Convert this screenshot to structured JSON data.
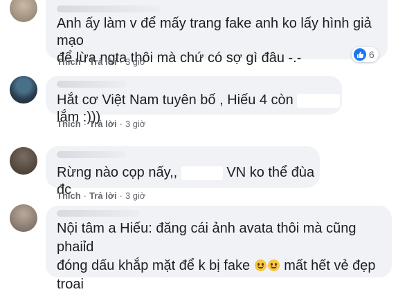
{
  "comments": [
    {
      "line1": "Anh ấy làm v để mấy trang fake anh ko lấy hình giả mạo",
      "line2": "để lừa ngta thôi mà chứ có sợ gì đâu -.-",
      "reaction_count": "6"
    },
    {
      "text_before": "Hắt cơ Việt Nam tuyên bố , Hiếu 4 còn",
      "text_after": "lắm :)))"
    },
    {
      "text_before": "Rừng nào cọp nấy,,",
      "text_after": "VN ko thể đùa đc"
    },
    {
      "line1": "Nội tâm a Hiếu: đăng cái ảnh avata thôi mà cũng phaiỉd",
      "line2_before": "đóng dấu khắp mặt để k bị fake",
      "line2_after": "mất hết vẻ đẹp",
      "line3": "troai"
    }
  ],
  "actions": {
    "like": "Thích",
    "reply": "Trả lời",
    "separator": "·",
    "time": "3 giờ"
  },
  "icons": {
    "like": "thumbs-up-icon",
    "emoji": "smiling-face-icon"
  },
  "colors": {
    "bubble": "#f0f2f5",
    "text": "#1c1e21",
    "meta": "#65676b",
    "like_blue": "#1877f2"
  }
}
